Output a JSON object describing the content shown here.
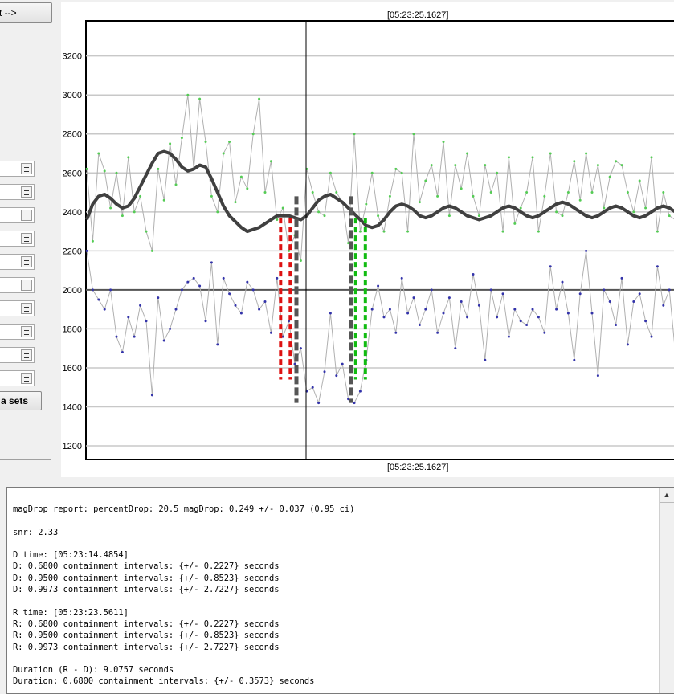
{
  "toolbar": {
    "next_label": "t -->",
    "datasets_label": "a sets"
  },
  "spinners": [
    {
      "value": ""
    },
    {
      "value": ""
    },
    {
      "value": ""
    },
    {
      "value": ""
    },
    {
      "value": ""
    },
    {
      "value": ""
    },
    {
      "value": ""
    },
    {
      "value": ""
    },
    {
      "value": ""
    },
    {
      "value": ""
    }
  ],
  "plot": {
    "cursor_time_top": "[05:23:25.1627]",
    "cursor_time_bottom": "[05:23:25.1627]"
  },
  "chart_data": {
    "type": "line",
    "title": "",
    "xlabel": "",
    "ylabel": "",
    "ylim": [
      1130,
      3380
    ],
    "yticks": [
      1200,
      1400,
      1600,
      1800,
      2000,
      2200,
      2400,
      2600,
      2800,
      3000,
      3200
    ],
    "grid": true,
    "reference_line": 2000,
    "cursor_x": 100,
    "x_count": 100,
    "series": [
      {
        "color": "#55cc55",
        "values": [
          2620,
          2250,
          2700,
          2610,
          2420,
          2600,
          2380,
          2680,
          2400,
          2480,
          2300,
          2200,
          2620,
          2460,
          2750,
          2540,
          2780,
          3000,
          2620,
          2980,
          2760,
          2480,
          2400,
          2700,
          2760,
          2450,
          2580,
          2520,
          2800,
          2980,
          2500,
          2660,
          2360,
          2420,
          2200,
          2280,
          2150,
          2620,
          2500,
          2400,
          2380,
          2600,
          2500,
          2450,
          2240,
          2800,
          2300,
          2440,
          2600,
          2380,
          2300,
          2480,
          2620,
          2600,
          2300,
          2800,
          2450,
          2560,
          2640,
          2480,
          2760,
          2380,
          2640,
          2520,
          2700,
          2480,
          2380,
          2640,
          2500,
          2600,
          2300,
          2680,
          2340,
          2420,
          2500,
          2680,
          2300,
          2480,
          2700,
          2400,
          2380,
          2500,
          2660,
          2460,
          2700,
          2500,
          2640,
          2420,
          2580,
          2660,
          2640,
          2500,
          2400,
          2560,
          2420,
          2680,
          2300,
          2500,
          2380,
          2360
        ]
      },
      {
        "color": "#3333aa",
        "values": [
          2200,
          2000,
          1950,
          1900,
          2000,
          1760,
          1680,
          1860,
          1760,
          1920,
          1840,
          1460,
          1960,
          1740,
          1800,
          1900,
          2000,
          2040,
          2060,
          2020,
          1840,
          2140,
          1720,
          2060,
          1980,
          1920,
          1880,
          2040,
          2000,
          1900,
          1940,
          1780,
          2060,
          1760,
          1840,
          1620,
          1700,
          1480,
          1500,
          1420,
          1580,
          1880,
          1560,
          1620,
          1440,
          1420,
          1480,
          1640,
          1900,
          2020,
          1860,
          1900,
          1780,
          2060,
          1880,
          1960,
          1820,
          1900,
          2000,
          1780,
          1880,
          1960,
          1700,
          1940,
          1860,
          2080,
          1920,
          1640,
          2000,
          1860,
          1980,
          1760,
          1900,
          1840,
          1820,
          1900,
          1860,
          1780,
          2120,
          1900,
          2040,
          1880,
          1640,
          1980,
          2200,
          1880,
          1560,
          2000,
          1940,
          1820,
          2060,
          1720,
          1940,
          1980,
          1840,
          1760,
          2120,
          1920,
          2000,
          1680
        ]
      },
      {
        "color": "#404040",
        "values": [
          2360,
          2440,
          2480,
          2490,
          2470,
          2440,
          2420,
          2430,
          2470,
          2530,
          2590,
          2650,
          2700,
          2710,
          2700,
          2670,
          2630,
          2610,
          2620,
          2640,
          2630,
          2570,
          2500,
          2430,
          2380,
          2350,
          2320,
          2300,
          2310,
          2320,
          2340,
          2360,
          2380,
          2380,
          2380,
          2370,
          2360,
          2380,
          2420,
          2460,
          2480,
          2490,
          2470,
          2450,
          2420,
          2390,
          2360,
          2330,
          2320,
          2330,
          2360,
          2400,
          2430,
          2440,
          2430,
          2410,
          2380,
          2370,
          2380,
          2400,
          2420,
          2430,
          2420,
          2400,
          2380,
          2370,
          2360,
          2370,
          2380,
          2400,
          2420,
          2430,
          2420,
          2400,
          2380,
          2370,
          2380,
          2400,
          2420,
          2440,
          2450,
          2440,
          2420,
          2400,
          2380,
          2370,
          2380,
          2400,
          2420,
          2430,
          2420,
          2400,
          2380,
          2370,
          2380,
          2400,
          2420,
          2430,
          2420,
          2400
        ]
      }
    ],
    "markers": [
      {
        "color": "#dd1111",
        "x": 94,
        "y_top": 2370,
        "y_bottom": 1540
      },
      {
        "color": "#11bb11",
        "x": 135,
        "y_top": 2370,
        "y_bottom": 1540
      },
      {
        "color": "#555555",
        "x": 100,
        "y_top": 2480,
        "y_bottom": 1420
      },
      {
        "color": "#555555",
        "x": 130,
        "y_top": 2480,
        "y_bottom": 1420
      }
    ]
  },
  "report": {
    "lines": [
      "magDrop report: percentDrop: 20.5 magDrop: 0.249 +/- 0.037 (0.95 ci)",
      "",
      "snr: 2.33",
      "",
      "D time: [05:23:14.4854]",
      "D: 0.6800 containment intervals: {+/- 0.2227} seconds",
      "D: 0.9500 containment intervals: {+/- 0.8523} seconds",
      "D: 0.9973 containment intervals: {+/- 2.7227} seconds",
      "",
      "R time: [05:23:23.5611]",
      "R: 0.6800 containment intervals: {+/- 0.2227} seconds",
      "R: 0.9500 containment intervals: {+/- 0.8523} seconds",
      "R: 0.9973 containment intervals: {+/- 2.7227} seconds",
      "",
      "Duration (R - D): 9.0757 seconds",
      "Duration: 0.6800 containment intervals: {+/- 0.3573} seconds"
    ]
  },
  "icons": {
    "scroll_up": "triangle-up-icon"
  }
}
